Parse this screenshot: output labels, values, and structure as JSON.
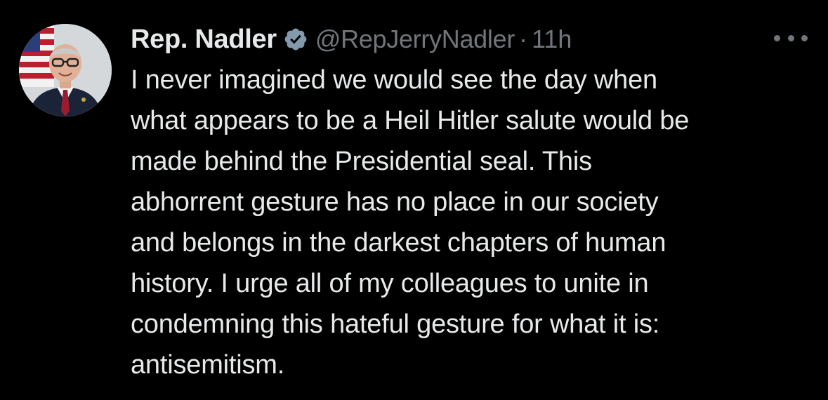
{
  "tweet": {
    "author": {
      "display_name": "Rep. Nadler",
      "handle": "@RepJerryNadler",
      "verified_icon": "verified-badge-icon",
      "avatar_icon": "profile-photo"
    },
    "separator": "·",
    "timestamp": "11h",
    "more_icon": "more-options-icon",
    "text_lines": [
      "I never imagined we would see the day when",
      "what appears to be a Heil Hitler salute would be",
      "made behind the Presidential seal. This",
      "abhorrent gesture has no place in our society",
      "and belongs in the darkest chapters of human",
      "history. I urge all of my colleagues to unite in",
      "condemning this hateful gesture for what it is:",
      "antisemitism."
    ]
  },
  "colors": {
    "background": "#000000",
    "primary_text": "#e7e9ea",
    "secondary_text": "#71767b",
    "verified_badge": "#829aab"
  }
}
